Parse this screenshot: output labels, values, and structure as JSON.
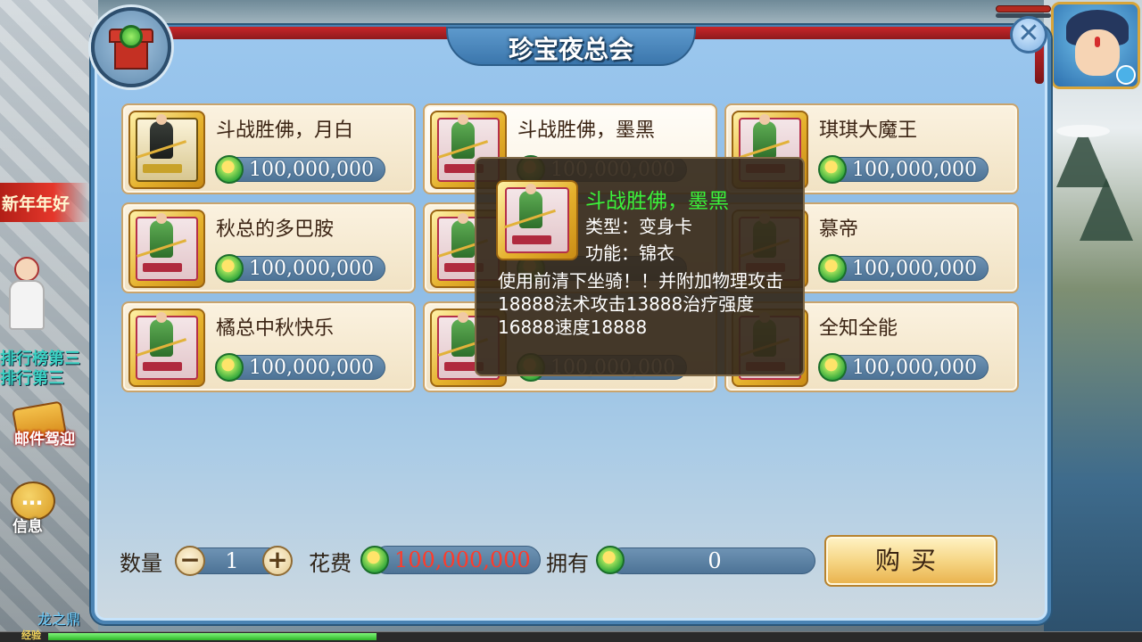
{
  "hud": {
    "left_banner": "新年年好",
    "rank_lines": [
      "排行榜第三",
      "排行第三"
    ],
    "mail_label": "邮件驾迎",
    "info_label": "信息",
    "world_text": "龙之鼎",
    "exp_label": "经验",
    "exp_fraction": 0.3
  },
  "panel": {
    "title": "珍宝夜总会",
    "close_symbol": "✕",
    "currency_icon": "green-gem-icon"
  },
  "items": [
    {
      "name": "斗战胜佛，月白",
      "price": "100,000,000",
      "selected": false,
      "style": "black"
    },
    {
      "name": "斗战胜佛，墨黑",
      "price": "100,000,000",
      "selected": true,
      "style": "red"
    },
    {
      "name": "琪琪大魔王",
      "price": "100,000,000",
      "selected": false,
      "style": "red"
    },
    {
      "name": "秋总的多巴胺",
      "price": "100,000,000",
      "selected": false,
      "style": "red"
    },
    {
      "name": "",
      "price": "",
      "selected": false,
      "style": "red"
    },
    {
      "name": "慕帝",
      "price": "100,000,000",
      "selected": false,
      "style": "red"
    },
    {
      "name": "橘总中秋快乐",
      "price": "100,000,000",
      "selected": false,
      "style": "red"
    },
    {
      "name": "",
      "price": "100,000,000",
      "selected": false,
      "style": "red"
    },
    {
      "name": "全知全能",
      "price": "100,000,000",
      "selected": false,
      "style": "red"
    }
  ],
  "tooltip": {
    "name": "斗战胜佛，墨黑",
    "type_line": "类型：变身卡",
    "function_line": "功能：锦衣",
    "description": "使用前清下坐骑！！并附加物理攻击18888法术攻击13888治疗强度16888速度18888"
  },
  "purchase": {
    "quantity_label": "数量",
    "quantity_value": "1",
    "minus_symbol": "−",
    "plus_symbol": "+",
    "cost_label": "花费",
    "cost_value": "100,000,000",
    "own_label": "拥有",
    "own_value": "0",
    "buy_label": "购买"
  },
  "colors": {
    "panel_blue": "#8cbbe6",
    "tooltip_name": "#3bf23a",
    "cost_red": "#ff3b2a",
    "card_bg": "#f1e2c3"
  }
}
